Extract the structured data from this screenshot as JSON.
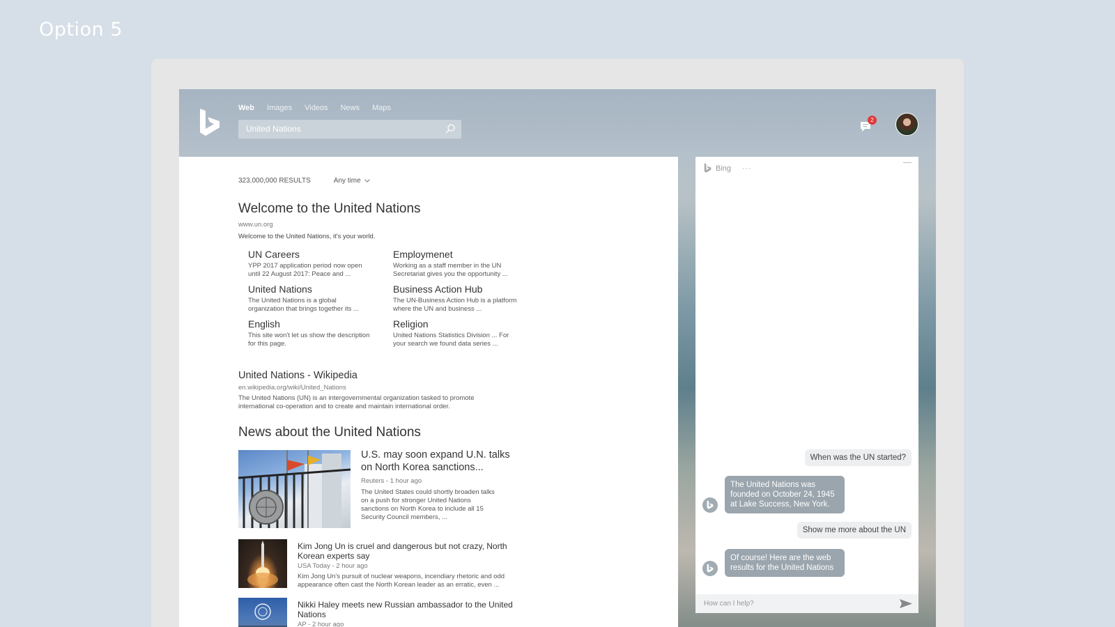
{
  "option_label": "Option 5",
  "nav": {
    "items": [
      "Web",
      "Images",
      "Videos",
      "News",
      "Maps"
    ],
    "active": "Web"
  },
  "search": {
    "value": "United Nations"
  },
  "notifications": {
    "count": "2"
  },
  "results": {
    "count": "323,000,000 RESULTS",
    "time_filter": "Any time",
    "main": {
      "title": "Welcome to the United Nations",
      "url": "www.un.org",
      "description": "Welcome to the United Nations, it's your world.",
      "deep_links": [
        {
          "title": "UN Careers",
          "desc": "YPP 2017 application period now open until 22 August 2017: Peace and ..."
        },
        {
          "title": "Employmenet",
          "desc": "Working as a staff member in the UN Secretariat gives you the opportunity ..."
        },
        {
          "title": "United Nations",
          "desc": "The United Nations is a global organization that brings together its ..."
        },
        {
          "title": "Business Action Hub",
          "desc": "The UN-Business Action Hub is a platform where the UN and business ..."
        },
        {
          "title": "English",
          "desc": "This site won't let us show the description for this page."
        },
        {
          "title": "Religion",
          "desc": "United Nations Statistics Division ... For your search we found data series ..."
        }
      ]
    },
    "wiki": {
      "title": "United Nations - Wikipedia",
      "url": "en.wikipedia.org/wiki/United_Nations",
      "description": "The United Nations (UN) is an intergovernmental organization tasked to promote international co-operation and to create and maintain international order."
    },
    "news_heading": "News about the United Nations",
    "news": [
      {
        "title": "U.S. may soon expand U.N. talks on North Korea sanctions...",
        "source": "Reuters - 1 hour ago",
        "desc": "The United States could shortly broaden talks on a push for stronger United Nations sanctions on North Korea to include all 15 Security Council members, ..."
      },
      {
        "title": "Kim Jong Un is cruel and dangerous but not crazy, North Korean experts say",
        "source": "USA Today - 2 hour ago",
        "desc": "Kim Jong Un's pursuit of nuclear weapons, incendiary rhetoric and odd appearance often cast the North Korean leader as an erratic, even ..."
      },
      {
        "title": "Nikki Haley meets new Russian ambassador to the United Nations",
        "source": "AP - 2 hour ago"
      }
    ]
  },
  "chat": {
    "title": "Bing",
    "more": "···",
    "messages": [
      {
        "from": "user",
        "text": "When was the UN started?"
      },
      {
        "from": "bot",
        "text": "The United Nations was founded on October 24, 1945 at Lake Success, New York."
      },
      {
        "from": "user",
        "text": "Show me more about the UN"
      },
      {
        "from": "bot",
        "text": "Of course! Here are the web results for the United Nations"
      }
    ],
    "input_placeholder": "How can I help?"
  }
}
